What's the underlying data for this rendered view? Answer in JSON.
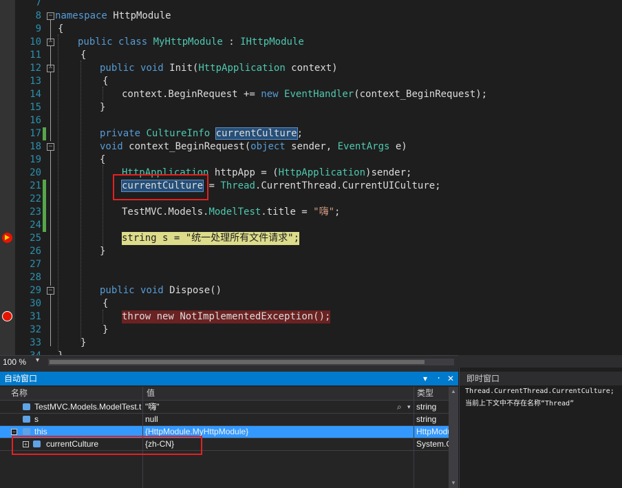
{
  "editor": {
    "line_numbers": [
      "7",
      "8",
      "9",
      "10",
      "11",
      "12",
      "13",
      "14",
      "15",
      "16",
      "17",
      "18",
      "19",
      "20",
      "21",
      "22",
      "23",
      "24",
      "25",
      "26",
      "27",
      "28",
      "29",
      "30",
      "31",
      "32",
      "33",
      "34"
    ],
    "lines": {
      "l8": {
        "kw": "namespace",
        "rest": " HttpModule"
      },
      "l9": "{",
      "l10": {
        "kw1": "public",
        "kw2": "class",
        "type": "MyHttpModule",
        "sep": " : ",
        "iface": "IHttpModule"
      },
      "l11": "{",
      "l12": {
        "kw1": "public",
        "kw2": "void",
        "name": " Init(",
        "type": "HttpApplication",
        "rest": " context)"
      },
      "l13": "{",
      "l14": {
        "a": "context.BeginRequest += ",
        "kw": "new",
        "type": "EventHandler",
        "rest": "(context_BeginRequest);"
      },
      "l15": "}",
      "l17": {
        "kw": "private",
        "type": "CultureInfo",
        "var": "currentCulture",
        "end": ";"
      },
      "l18": {
        "kw": "void",
        "name": " context_BeginRequest(",
        "kw2": "object",
        "mid": " sender, ",
        "type": "EventArgs",
        "rest": " e)"
      },
      "l19": "{",
      "l20": {
        "type": "HttpApplication",
        "mid": " httpApp = (",
        "type2": "HttpApplication",
        "rest": ")sender;"
      },
      "l21": {
        "var": "currentCulture",
        "mid": " = ",
        "type": "Thread",
        "rest": ".CurrentThread.CurrentUICulture;"
      },
      "l23": {
        "a": "TestMVC.Models.",
        "type": "ModelTest",
        "mid": ".title = ",
        "str": "\"嗨\"",
        "end": ";"
      },
      "l25": {
        "kw": "string",
        "mid": " s = ",
        "str": "\"统一处理所有文件请求\"",
        "end": ";"
      },
      "l26": "}",
      "l29": {
        "kw1": "public",
        "kw2": "void",
        "rest": " Dispose()"
      },
      "l30": "{",
      "l31": {
        "kw1": "throw",
        "kw2": "new",
        "rest": " NotImplementedException();"
      },
      "l32": "}",
      "l33": "}",
      "l34": "}"
    }
  },
  "status": {
    "zoom": "100 %",
    "zoom_arrow": "▾"
  },
  "autos": {
    "title": "自动窗口",
    "buttons": {
      "dropdown": "▾",
      "pin": "᛫",
      "close": "✕"
    },
    "columns": {
      "name": "名称",
      "value": "值",
      "type": "类型"
    },
    "rows": [
      {
        "name": "TestMVC.Models.ModelTest.title",
        "value": "\"嗨\"",
        "type": "string"
      },
      {
        "name": "s",
        "value": "null",
        "type": "string"
      },
      {
        "name": "this",
        "value": "{HttpModule.MyHttpModule}",
        "type": "HttpModule.MyHttpModule"
      },
      {
        "name": "currentCulture",
        "value": "{zh-CN}",
        "type": "System.Globalization.CultureInfo"
      }
    ],
    "expand_minus": "−",
    "expand_plus": "+",
    "search_icon": "⌕"
  },
  "immediate": {
    "title": "即时窗口",
    "lines": [
      "Thread.CurrentThread.CurrentCulture;",
      "当前上下文中不存在名称“Thread”"
    ]
  },
  "colors": {
    "accent": "#007acc",
    "breakpoint": "#e51400",
    "highlight_box": "#e62020"
  }
}
